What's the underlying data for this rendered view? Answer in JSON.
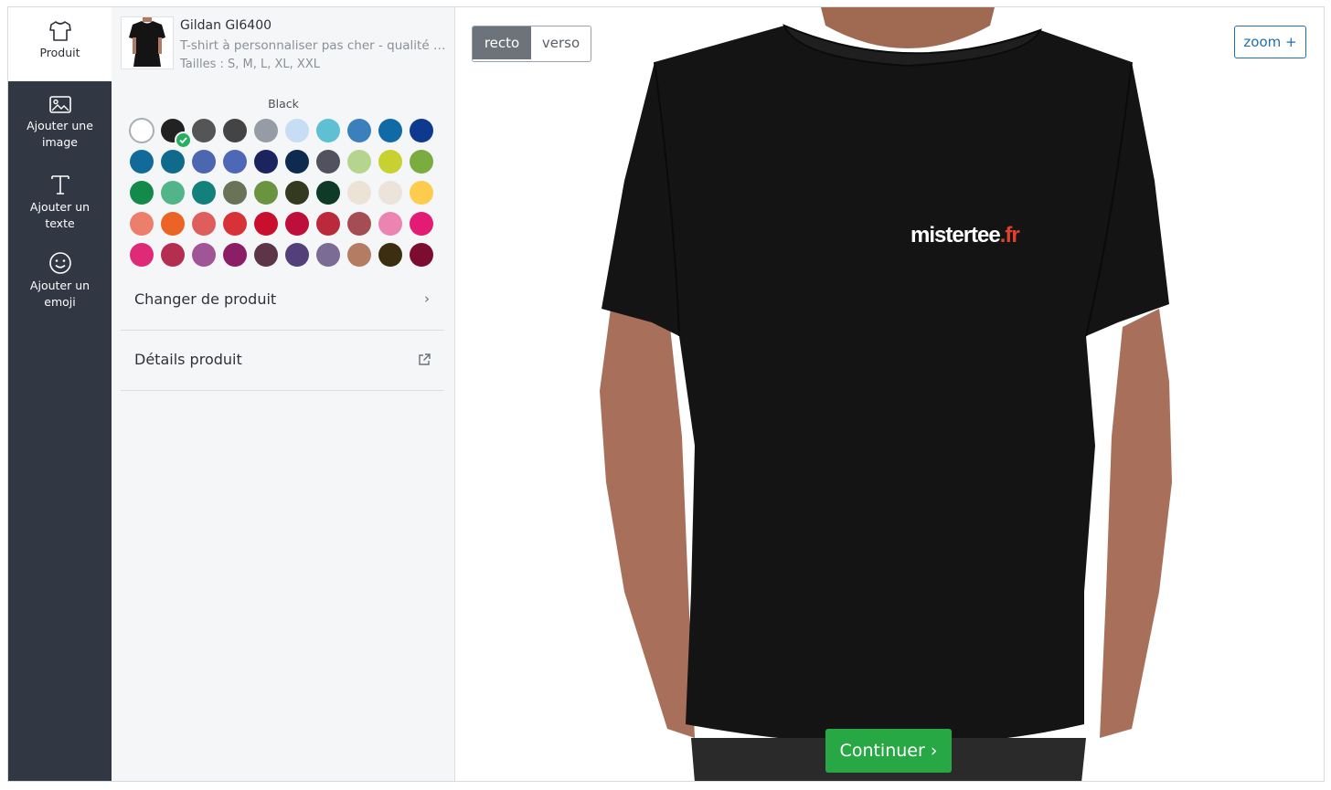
{
  "rail": {
    "items": [
      {
        "label": "Produit",
        "icon": "tshirt-icon"
      },
      {
        "label": "Ajouter une image",
        "icon": "image-icon"
      },
      {
        "label": "Ajouter un texte",
        "icon": "text-icon"
      },
      {
        "label": "Ajouter un emoji",
        "icon": "smiley-icon"
      }
    ]
  },
  "product": {
    "name": "Gildan GI6400",
    "description": "T-shirt à personnaliser pas cher - qualité premium",
    "sizes": "Tailles : S, M, L, XL, XXL",
    "selected_color_name": "Black",
    "swatches": [
      "#ffffff",
      "#222222",
      "#555555",
      "#444444",
      "#959ca5",
      "#c7ddf4",
      "#5fbfd3",
      "#3c7fbd",
      "#0f6aa6",
      "#0d3a8f",
      "#126a9a",
      "#0e6b8c",
      "#4c66b0",
      "#4f68b6",
      "#1c2460",
      "#0e2a4f",
      "#51525d",
      "#b5d58e",
      "#c7d230",
      "#7bac3f",
      "#138a4a",
      "#52b58a",
      "#14807b",
      "#6a7358",
      "#6b9440",
      "#333a1f",
      "#0f3a28",
      "#ece2d6",
      "#ece3da",
      "#fecc4c",
      "#ec7e6c",
      "#eb6325",
      "#df5d5d",
      "#d63238",
      "#c8102e",
      "#bd0f3a",
      "#bb2a3c",
      "#a54d55",
      "#ec84b1",
      "#e41b75",
      "#df2a78",
      "#b42e52",
      "#a05596",
      "#8c1e66",
      "#5d3549",
      "#53407a",
      "#7b6c96",
      "#b47d63",
      "#3b2f10",
      "#7c0c30"
    ]
  },
  "menu": {
    "change_product": "Changer de produit",
    "change_arrow": "›",
    "details": "Détails produit"
  },
  "stage": {
    "recto": "recto",
    "verso": "verso",
    "zoom": "zoom +",
    "logo_main": "mistertee",
    "logo_tld": ".fr",
    "continue": "Continuer ›"
  },
  "colors": {
    "rail_bg": "#313843",
    "accent_green": "#28a745",
    "link_blue": "#1f6fb2",
    "shirt": "#141414",
    "logo_red": "#e2412f"
  }
}
